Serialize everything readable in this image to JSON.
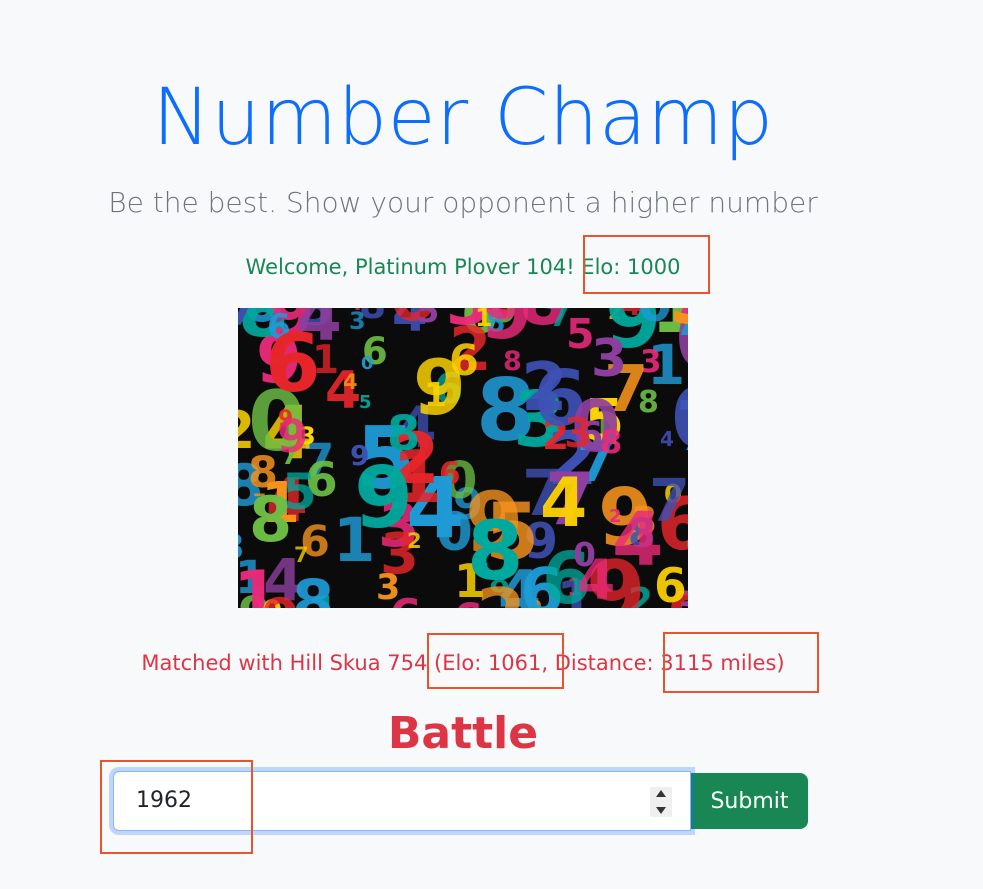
{
  "header": {
    "title": "Number Champ",
    "subtitle": "Be the best. Show your opponent a higher number"
  },
  "welcome": {
    "text": "Welcome, Platinum Plover 104! Elo: 1000"
  },
  "hero_image": {
    "description": "number-collage-icon"
  },
  "match": {
    "text": "Matched with Hill Skua 754 (Elo: 1061, Distance: 3115 miles)"
  },
  "battle": {
    "heading": "Battle",
    "input_value": "1962",
    "submit_label": "Submit"
  },
  "colors": {
    "title": "#0d6efd",
    "subtitle": "#6c757d",
    "welcome": "#198754",
    "match": "#dc3545",
    "submit_bg": "#198754",
    "highlight": "#e8542c"
  }
}
